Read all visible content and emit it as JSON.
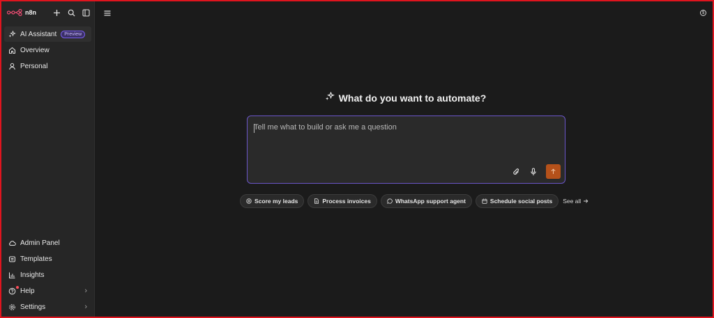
{
  "app": {
    "name": "n8n"
  },
  "sidebar": {
    "items": [
      {
        "label": "AI Assistant",
        "badge": "Preview",
        "icon": "sparkles-icon"
      },
      {
        "label": "Overview",
        "icon": "home-icon"
      },
      {
        "label": "Personal",
        "icon": "user-icon"
      }
    ],
    "bottom_items": [
      {
        "label": "Admin Panel",
        "icon": "cloud-icon"
      },
      {
        "label": "Templates",
        "icon": "templates-icon"
      },
      {
        "label": "Insights",
        "icon": "chart-icon"
      },
      {
        "label": "Help",
        "icon": "help-icon",
        "has_chevron": true
      },
      {
        "label": "Settings",
        "icon": "gear-icon",
        "has_chevron": true
      }
    ]
  },
  "main": {
    "heading": "What do you want to automate?",
    "prompt_placeholder": "Tell me what to build or ask me a question",
    "prompt_value": "",
    "suggestions": [
      {
        "label": "Score my leads",
        "icon": "target-icon"
      },
      {
        "label": "Process invoices",
        "icon": "document-icon"
      },
      {
        "label": "WhatsApp support agent",
        "icon": "chat-bubble-icon"
      },
      {
        "label": "Schedule social posts",
        "icon": "calendar-icon"
      }
    ],
    "see_all": "See all"
  },
  "colors": {
    "accent": "#b5511a",
    "focus_border": "#6b56c9",
    "brand": "#ea4b71",
    "sidebar_bg": "#262626",
    "main_bg": "#1b1b1b"
  }
}
